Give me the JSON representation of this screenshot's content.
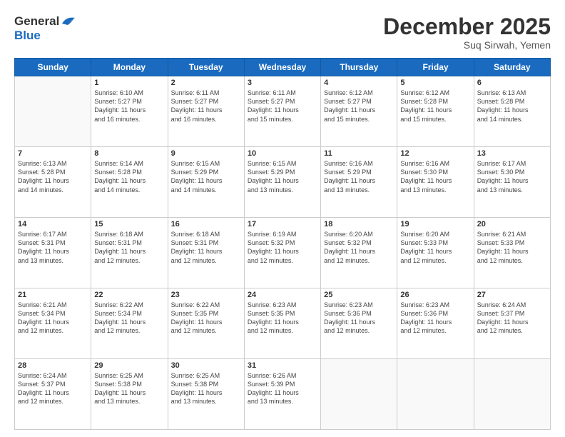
{
  "logo": {
    "line1": "General",
    "line2": "Blue"
  },
  "header": {
    "month": "December 2025",
    "location": "Suq Sirwah, Yemen"
  },
  "days_of_week": [
    "Sunday",
    "Monday",
    "Tuesday",
    "Wednesday",
    "Thursday",
    "Friday",
    "Saturday"
  ],
  "weeks": [
    [
      {
        "day": "",
        "content": ""
      },
      {
        "day": "1",
        "content": "Sunrise: 6:10 AM\nSunset: 5:27 PM\nDaylight: 11 hours\nand 16 minutes."
      },
      {
        "day": "2",
        "content": "Sunrise: 6:11 AM\nSunset: 5:27 PM\nDaylight: 11 hours\nand 16 minutes."
      },
      {
        "day": "3",
        "content": "Sunrise: 6:11 AM\nSunset: 5:27 PM\nDaylight: 11 hours\nand 15 minutes."
      },
      {
        "day": "4",
        "content": "Sunrise: 6:12 AM\nSunset: 5:27 PM\nDaylight: 11 hours\nand 15 minutes."
      },
      {
        "day": "5",
        "content": "Sunrise: 6:12 AM\nSunset: 5:28 PM\nDaylight: 11 hours\nand 15 minutes."
      },
      {
        "day": "6",
        "content": "Sunrise: 6:13 AM\nSunset: 5:28 PM\nDaylight: 11 hours\nand 14 minutes."
      }
    ],
    [
      {
        "day": "7",
        "content": "Sunrise: 6:13 AM\nSunset: 5:28 PM\nDaylight: 11 hours\nand 14 minutes."
      },
      {
        "day": "8",
        "content": "Sunrise: 6:14 AM\nSunset: 5:28 PM\nDaylight: 11 hours\nand 14 minutes."
      },
      {
        "day": "9",
        "content": "Sunrise: 6:15 AM\nSunset: 5:29 PM\nDaylight: 11 hours\nand 14 minutes."
      },
      {
        "day": "10",
        "content": "Sunrise: 6:15 AM\nSunset: 5:29 PM\nDaylight: 11 hours\nand 13 minutes."
      },
      {
        "day": "11",
        "content": "Sunrise: 6:16 AM\nSunset: 5:29 PM\nDaylight: 11 hours\nand 13 minutes."
      },
      {
        "day": "12",
        "content": "Sunrise: 6:16 AM\nSunset: 5:30 PM\nDaylight: 11 hours\nand 13 minutes."
      },
      {
        "day": "13",
        "content": "Sunrise: 6:17 AM\nSunset: 5:30 PM\nDaylight: 11 hours\nand 13 minutes."
      }
    ],
    [
      {
        "day": "14",
        "content": "Sunrise: 6:17 AM\nSunset: 5:31 PM\nDaylight: 11 hours\nand 13 minutes."
      },
      {
        "day": "15",
        "content": "Sunrise: 6:18 AM\nSunset: 5:31 PM\nDaylight: 11 hours\nand 12 minutes."
      },
      {
        "day": "16",
        "content": "Sunrise: 6:18 AM\nSunset: 5:31 PM\nDaylight: 11 hours\nand 12 minutes."
      },
      {
        "day": "17",
        "content": "Sunrise: 6:19 AM\nSunset: 5:32 PM\nDaylight: 11 hours\nand 12 minutes."
      },
      {
        "day": "18",
        "content": "Sunrise: 6:20 AM\nSunset: 5:32 PM\nDaylight: 11 hours\nand 12 minutes."
      },
      {
        "day": "19",
        "content": "Sunrise: 6:20 AM\nSunset: 5:33 PM\nDaylight: 11 hours\nand 12 minutes."
      },
      {
        "day": "20",
        "content": "Sunrise: 6:21 AM\nSunset: 5:33 PM\nDaylight: 11 hours\nand 12 minutes."
      }
    ],
    [
      {
        "day": "21",
        "content": "Sunrise: 6:21 AM\nSunset: 5:34 PM\nDaylight: 11 hours\nand 12 minutes."
      },
      {
        "day": "22",
        "content": "Sunrise: 6:22 AM\nSunset: 5:34 PM\nDaylight: 11 hours\nand 12 minutes."
      },
      {
        "day": "23",
        "content": "Sunrise: 6:22 AM\nSunset: 5:35 PM\nDaylight: 11 hours\nand 12 minutes."
      },
      {
        "day": "24",
        "content": "Sunrise: 6:23 AM\nSunset: 5:35 PM\nDaylight: 11 hours\nand 12 minutes."
      },
      {
        "day": "25",
        "content": "Sunrise: 6:23 AM\nSunset: 5:36 PM\nDaylight: 11 hours\nand 12 minutes."
      },
      {
        "day": "26",
        "content": "Sunrise: 6:23 AM\nSunset: 5:36 PM\nDaylight: 11 hours\nand 12 minutes."
      },
      {
        "day": "27",
        "content": "Sunrise: 6:24 AM\nSunset: 5:37 PM\nDaylight: 11 hours\nand 12 minutes."
      }
    ],
    [
      {
        "day": "28",
        "content": "Sunrise: 6:24 AM\nSunset: 5:37 PM\nDaylight: 11 hours\nand 12 minutes."
      },
      {
        "day": "29",
        "content": "Sunrise: 6:25 AM\nSunset: 5:38 PM\nDaylight: 11 hours\nand 13 minutes."
      },
      {
        "day": "30",
        "content": "Sunrise: 6:25 AM\nSunset: 5:38 PM\nDaylight: 11 hours\nand 13 minutes."
      },
      {
        "day": "31",
        "content": "Sunrise: 6:26 AM\nSunset: 5:39 PM\nDaylight: 11 hours\nand 13 minutes."
      },
      {
        "day": "",
        "content": ""
      },
      {
        "day": "",
        "content": ""
      },
      {
        "day": "",
        "content": ""
      }
    ]
  ]
}
